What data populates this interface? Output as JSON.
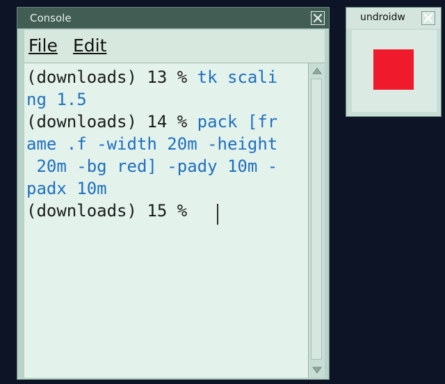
{
  "console": {
    "title": "Console",
    "menu": {
      "file": "File",
      "edit": "Edit"
    },
    "lines": [
      {
        "prompt": "(downloads) 13 % ",
        "cmd": "tk scali"
      },
      {
        "prompt": "",
        "cmd": "ng 1.5"
      },
      {
        "prompt": "(downloads) 14 % ",
        "cmd": "pack [fr"
      },
      {
        "prompt": "",
        "cmd": "ame .f -width 20m -height"
      },
      {
        "prompt": "",
        "cmd": " 20m -bg red] -pady 10m -"
      },
      {
        "prompt": "",
        "cmd": "padx 10m"
      },
      {
        "prompt": "(downloads) 15 % ",
        "cmd": ""
      }
    ]
  },
  "toplevel": {
    "title": "undroidw",
    "frame_color": "#ef1b2d"
  },
  "icons": {
    "close": "close-x-icon",
    "scroll_up": "arrow-up-icon",
    "scroll_down": "arrow-down-icon"
  }
}
